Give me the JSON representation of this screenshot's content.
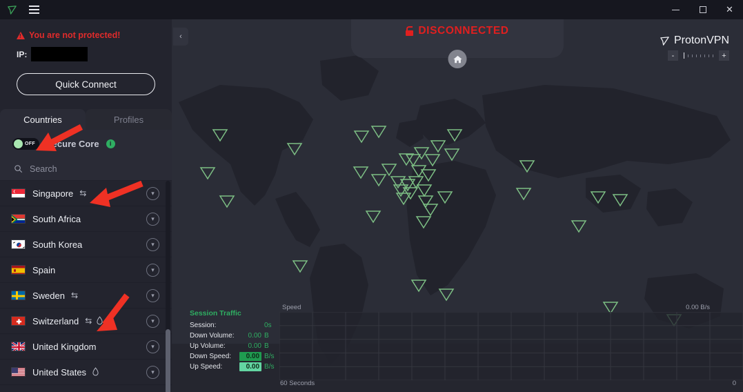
{
  "titlebar": {
    "logo_icon": "protonvpn-logo-icon",
    "menu_icon": "hamburger-menu-icon",
    "minimize_label": "",
    "maximize_label": "",
    "close_label": "✕"
  },
  "sidebar": {
    "protection_warning": "You are not protected!",
    "warning_icon": "warning-triangle-icon",
    "ip_label": "IP:",
    "ip_value": "",
    "quick_connect_label": "Quick Connect",
    "tabs": [
      {
        "label": "Countries",
        "active": true
      },
      {
        "label": "Profiles",
        "active": false
      }
    ],
    "secure_core": {
      "toggle_state": "OFF",
      "label": "Secure Core",
      "info_icon": "info-icon",
      "info_glyph": "i"
    },
    "search": {
      "placeholder": "Search",
      "value": "",
      "icon": "search-icon"
    },
    "countries": [
      {
        "name": "Singapore",
        "flag": "sg",
        "p2p": true,
        "tor": false
      },
      {
        "name": "South Africa",
        "flag": "za",
        "p2p": false,
        "tor": false
      },
      {
        "name": "South Korea",
        "flag": "kr",
        "p2p": false,
        "tor": false
      },
      {
        "name": "Spain",
        "flag": "es",
        "p2p": false,
        "tor": false
      },
      {
        "name": "Sweden",
        "flag": "se",
        "p2p": true,
        "tor": false
      },
      {
        "name": "Switzerland",
        "flag": "ch",
        "p2p": true,
        "tor": true
      },
      {
        "name": "United Kingdom",
        "flag": "gb",
        "p2p": false,
        "tor": false
      },
      {
        "name": "United States",
        "flag": "us",
        "p2p": false,
        "tor": true
      }
    ],
    "expand_chevron_glyph": "▾"
  },
  "map": {
    "collapse_icon": "chevron-left-icon",
    "collapse_glyph": "‹",
    "status_text": "DISCONNECTED",
    "status_icon": "unlocked-padlock-icon",
    "status_color": "#e01f1f",
    "home_icon": "home-icon",
    "brand_name": "ProtonVPN",
    "brand_icon": "protonvpn-logo-icon",
    "zoom_out_label": "-",
    "zoom_in_label": "+",
    "zoom_level": 1,
    "server_marker_icon": "server-triangle-marker-icon",
    "server_marker_color": "#7dbf84"
  },
  "traffic": {
    "title": "Session Traffic",
    "rows": [
      {
        "key": "Session:",
        "value": "",
        "unit": "0s",
        "highlight": "none"
      },
      {
        "key": "Down Volume:",
        "value": "0.00",
        "unit": "B",
        "highlight": "none"
      },
      {
        "key": "Up Volume:",
        "value": "0.00",
        "unit": "B",
        "highlight": "none"
      },
      {
        "key": "Down Speed:",
        "value": "0.00",
        "unit": "B/s",
        "highlight": "down"
      },
      {
        "key": "Up Speed:",
        "value": "0.00",
        "unit": "B/s",
        "highlight": "up"
      }
    ]
  },
  "chart": {
    "y_axis_label": "Speed",
    "x_axis_label": "60 Seconds",
    "max_rate_label": "0.00 B/s",
    "min_label": "0"
  },
  "annotations": {
    "arrow_color": "#ef3124",
    "arrow_1_target": "secure-core-toggle",
    "arrow_2_target": "country-row-singapore",
    "arrow_3_target": "switzerland-tor-icon"
  }
}
